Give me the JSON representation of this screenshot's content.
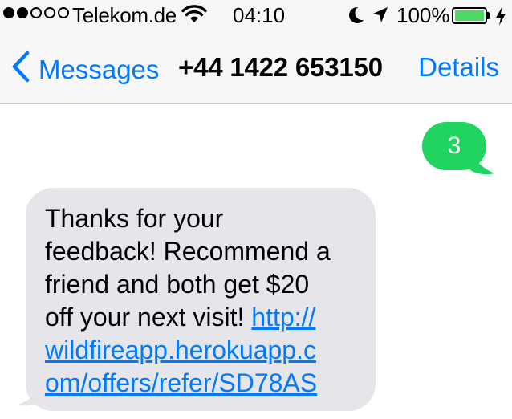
{
  "status_bar": {
    "carrier": "Telekom.de",
    "time": "04:10",
    "battery_percent": "100%",
    "signal_bars_filled": 2,
    "signal_bars_total": 5,
    "battery_level": 1.0,
    "icons": [
      "wifi-icon",
      "moon-icon",
      "location-arrow-icon",
      "battery-icon",
      "charging-bolt-icon"
    ]
  },
  "nav": {
    "back_label": "Messages",
    "title": "+44 1422 653150",
    "details_label": "Details"
  },
  "messages": [
    {
      "direction": "outgoing",
      "text": "3"
    },
    {
      "direction": "incoming",
      "lines": [
        "Thanks for your",
        "feedback! Recommend a",
        "friend and both get $20",
        "off your next visit! "
      ],
      "link_lines": [
        "http://",
        "wildfireapp.herokuapp.c",
        "om/offers/refer/SD78AS"
      ]
    }
  ],
  "colors": {
    "accent": "#007aff",
    "outgoing_bubble": "#21d35f",
    "incoming_bubble": "#e5e5ea",
    "battery": "#4cd964"
  }
}
